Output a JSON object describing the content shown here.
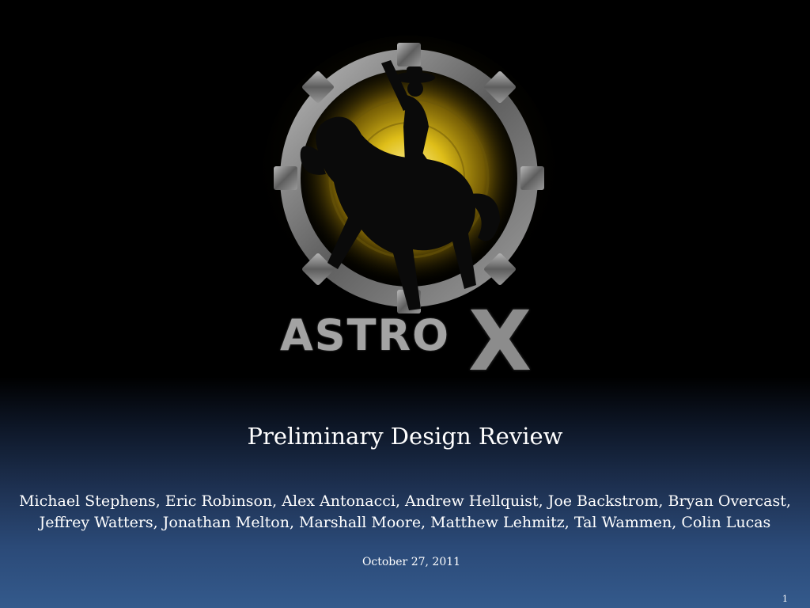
{
  "logo": {
    "word_astro": "ASTRO",
    "word_x": "X"
  },
  "title": "Preliminary Design Review",
  "authors_line1": "Michael Stephens, Eric Robinson, Alex Antonacci, Andrew Hellquist, Joe Backstrom, Bryan Overcast,",
  "authors_line2": "Jeffrey Watters, Jonathan Melton, Marshall Moore, Matthew Lehmitz, Tal Wammen, Colin Lucas",
  "date": "October 27, 2011",
  "page_number": "1",
  "colors": {
    "background_top": "#000000",
    "background_bottom": "#345a8c",
    "logo_glow": "#e8c61a",
    "logo_gear": "#7a7a7a"
  }
}
